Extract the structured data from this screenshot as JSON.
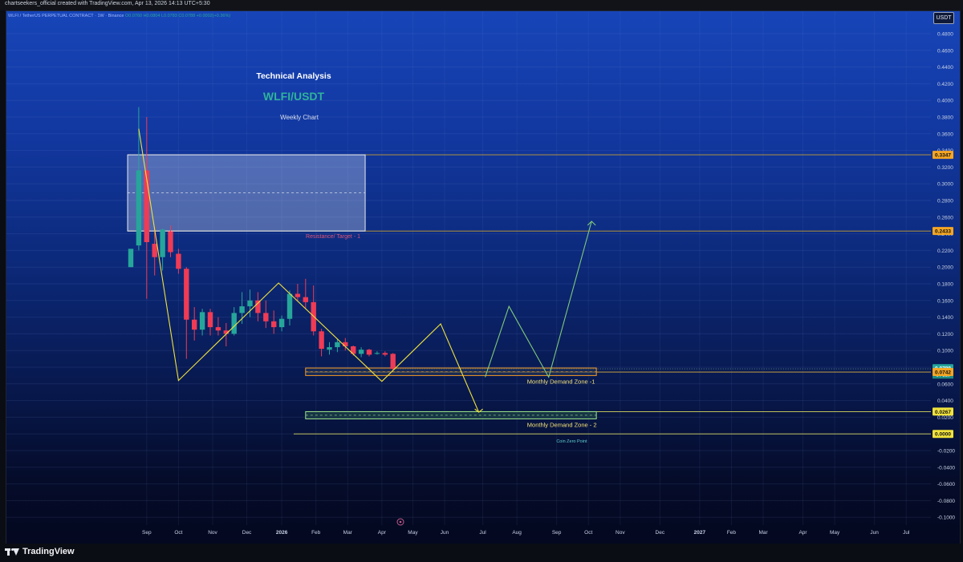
{
  "header": {
    "creator_line": "chartseekers_official created with TradingView.com, Apr 13, 2026 14:13 UTC+5:30",
    "symbol": "WLFI / TetherUS PERPETUAL CONTRACT · 1W · Binance",
    "ohlc": "O0.0760 H0.0804 L0.0783 C0.0788 +0.0002(+0.36%)",
    "price_unit": "USDT"
  },
  "footer": {
    "brand": "TradingView"
  },
  "colors": {
    "up": "#26a69a",
    "down": "#ef3b55",
    "pattern": "#f0e23c",
    "projection_up": "#7fc97a",
    "resistance_box": "#e8ecf3",
    "demand_zone_1": "#f59a23",
    "demand_zone_2": "#9be28a"
  },
  "chart_data": {
    "type": "candlestick",
    "title": "Technical Analysis",
    "subtitle": "WLFI/USDT",
    "caption": "Weekly Chart",
    "ylim": [
      -0.1,
      0.5
    ],
    "y_ticks": [
      "0.4800",
      "0.4600",
      "0.4400",
      "0.4200",
      "0.4000",
      "0.3800",
      "0.3600",
      "0.3400",
      "0.3200",
      "0.3000",
      "0.2800",
      "0.2600",
      "0.2400",
      "0.2200",
      "0.2000",
      "0.1800",
      "0.1600",
      "0.1400",
      "0.1200",
      "0.1000",
      "0.0800",
      "0.0600",
      "0.0400",
      "0.0200",
      "0.0000",
      "-0.0200",
      "-0.0400",
      "-0.0600",
      "-0.0800",
      "-0.1000"
    ],
    "x_ticks": [
      {
        "label": "Sep",
        "w": 2
      },
      {
        "label": "Oct",
        "w": 6
      },
      {
        "label": "Nov",
        "w": 10.3
      },
      {
        "label": "Dec",
        "w": 14.6
      },
      {
        "label": "2026",
        "w": 19,
        "bold": true
      },
      {
        "label": "Feb",
        "w": 23.3
      },
      {
        "label": "Mar",
        "w": 27.3
      },
      {
        "label": "Apr",
        "w": 31.6
      },
      {
        "label": "May",
        "w": 35.5
      },
      {
        "label": "Jun",
        "w": 39.5
      },
      {
        "label": "Jul",
        "w": 44.3
      },
      {
        "label": "Aug",
        "w": 48.6
      },
      {
        "label": "Sep",
        "w": 53.6
      },
      {
        "label": "Oct",
        "w": 57.6
      },
      {
        "label": "Nov",
        "w": 61.6
      },
      {
        "label": "Dec",
        "w": 66.6
      },
      {
        "label": "2027",
        "w": 71.6,
        "bold": true
      },
      {
        "label": "Feb",
        "w": 75.6
      },
      {
        "label": "Mar",
        "w": 79.6
      },
      {
        "label": "Apr",
        "w": 84.6
      },
      {
        "label": "May",
        "w": 88.6
      },
      {
        "label": "Jun",
        "w": 93.6
      },
      {
        "label": "Jul",
        "w": 97.6
      }
    ],
    "candles": [
      {
        "o": 0.2,
        "h": 0.22,
        "l": 0.2,
        "c": 0.222
      },
      {
        "o": 0.226,
        "h": 0.392,
        "l": 0.22,
        "c": 0.316
      },
      {
        "o": 0.316,
        "h": 0.38,
        "l": 0.162,
        "c": 0.23
      },
      {
        "o": 0.228,
        "h": 0.248,
        "l": 0.19,
        "c": 0.212
      },
      {
        "o": 0.212,
        "h": 0.246,
        "l": 0.196,
        "c": 0.245
      },
      {
        "o": 0.243,
        "h": 0.25,
        "l": 0.212,
        "c": 0.218
      },
      {
        "o": 0.216,
        "h": 0.222,
        "l": 0.192,
        "c": 0.198
      },
      {
        "o": 0.198,
        "h": 0.2,
        "l": 0.09,
        "c": 0.137
      },
      {
        "o": 0.137,
        "h": 0.152,
        "l": 0.112,
        "c": 0.125
      },
      {
        "o": 0.125,
        "h": 0.15,
        "l": 0.118,
        "c": 0.146
      },
      {
        "o": 0.146,
        "h": 0.15,
        "l": 0.118,
        "c": 0.128
      },
      {
        "o": 0.128,
        "h": 0.14,
        "l": 0.118,
        "c": 0.124
      },
      {
        "o": 0.124,
        "h": 0.133,
        "l": 0.105,
        "c": 0.12
      },
      {
        "o": 0.12,
        "h": 0.152,
        "l": 0.118,
        "c": 0.145
      },
      {
        "o": 0.145,
        "h": 0.17,
        "l": 0.132,
        "c": 0.153
      },
      {
        "o": 0.153,
        "h": 0.173,
        "l": 0.14,
        "c": 0.16
      },
      {
        "o": 0.16,
        "h": 0.17,
        "l": 0.135,
        "c": 0.145
      },
      {
        "o": 0.145,
        "h": 0.16,
        "l": 0.127,
        "c": 0.135
      },
      {
        "o": 0.135,
        "h": 0.148,
        "l": 0.12,
        "c": 0.128
      },
      {
        "o": 0.128,
        "h": 0.142,
        "l": 0.123,
        "c": 0.138
      },
      {
        "o": 0.138,
        "h": 0.172,
        "l": 0.13,
        "c": 0.168
      },
      {
        "o": 0.168,
        "h": 0.18,
        "l": 0.16,
        "c": 0.164
      },
      {
        "o": 0.164,
        "h": 0.186,
        "l": 0.15,
        "c": 0.158
      },
      {
        "o": 0.158,
        "h": 0.178,
        "l": 0.118,
        "c": 0.123
      },
      {
        "o": 0.123,
        "h": 0.126,
        "l": 0.093,
        "c": 0.102
      },
      {
        "o": 0.101,
        "h": 0.11,
        "l": 0.095,
        "c": 0.104
      },
      {
        "o": 0.104,
        "h": 0.114,
        "l": 0.098,
        "c": 0.11
      },
      {
        "o": 0.11,
        "h": 0.115,
        "l": 0.1,
        "c": 0.105
      },
      {
        "o": 0.105,
        "h": 0.106,
        "l": 0.094,
        "c": 0.096
      },
      {
        "o": 0.096,
        "h": 0.104,
        "l": 0.092,
        "c": 0.101
      },
      {
        "o": 0.101,
        "h": 0.102,
        "l": 0.093,
        "c": 0.095
      },
      {
        "o": 0.096,
        "h": 0.099,
        "l": 0.095,
        "c": 0.097
      },
      {
        "o": 0.097,
        "h": 0.099,
        "l": 0.093,
        "c": 0.095
      },
      {
        "o": 0.096,
        "h": 0.097,
        "l": 0.076,
        "c": 0.078
      }
    ],
    "price_tags": [
      {
        "value": 0.3347,
        "label": "0.3347",
        "style": "orange"
      },
      {
        "value": 0.2433,
        "label": "0.2433",
        "style": "orange"
      },
      {
        "value": 0.0788,
        "label": "0.0788",
        "style": "green"
      },
      {
        "value": 0.0742,
        "label": "0.0742",
        "style": "orange"
      },
      {
        "value": 0.0267,
        "label": "0.0267",
        "style": "yellow"
      },
      {
        "value": 0.0,
        "label": "0.0000",
        "style": "yellow"
      }
    ],
    "last_price_countdown": "04 16h",
    "horizontal_lines": [
      {
        "value": 0.3347,
        "from_w": -0.4,
        "color": "#c8a030"
      },
      {
        "value": 0.2433,
        "from_w": -0.4,
        "color": "#c8a030"
      },
      {
        "value": 0.0742,
        "from_w": 22.0,
        "color": "#e0b040"
      },
      {
        "value": 0.0267,
        "from_w": 22.0,
        "color": "#d8d860"
      },
      {
        "value": 0.0,
        "from_w": 20.5,
        "color": "#d8d860"
      }
    ],
    "zones": [
      {
        "name": "Resistance/ Target - 1",
        "top": 0.3347,
        "bottom": 0.2433,
        "x0": -0.4,
        "x1": 29.5,
        "kind": "resistance"
      },
      {
        "name": "Monthly Demand Zone -1",
        "top": 0.079,
        "bottom": 0.07,
        "x0": 22.0,
        "x1": 58.6,
        "kind": "demand1"
      },
      {
        "name": "Monthly Demand Zone - 2",
        "top": 0.0267,
        "bottom": 0.018,
        "x0": 22.0,
        "x1": 58.6,
        "kind": "demand2"
      }
    ],
    "annotations": [
      {
        "text": "Coin Zero Point",
        "w": 55.5,
        "y": -0.0045
      }
    ],
    "pattern_path": [
      [
        1,
        0.366
      ],
      [
        6,
        0.064
      ],
      [
        18.6,
        0.181
      ],
      [
        31.6,
        0.063
      ],
      [
        39.0,
        0.132
      ],
      [
        43.8,
        0.026
      ]
    ],
    "projection_path": [
      [
        44.6,
        0.068
      ],
      [
        47.6,
        0.153
      ],
      [
        52.6,
        0.068
      ],
      [
        58.0,
        0.255
      ]
    ]
  }
}
